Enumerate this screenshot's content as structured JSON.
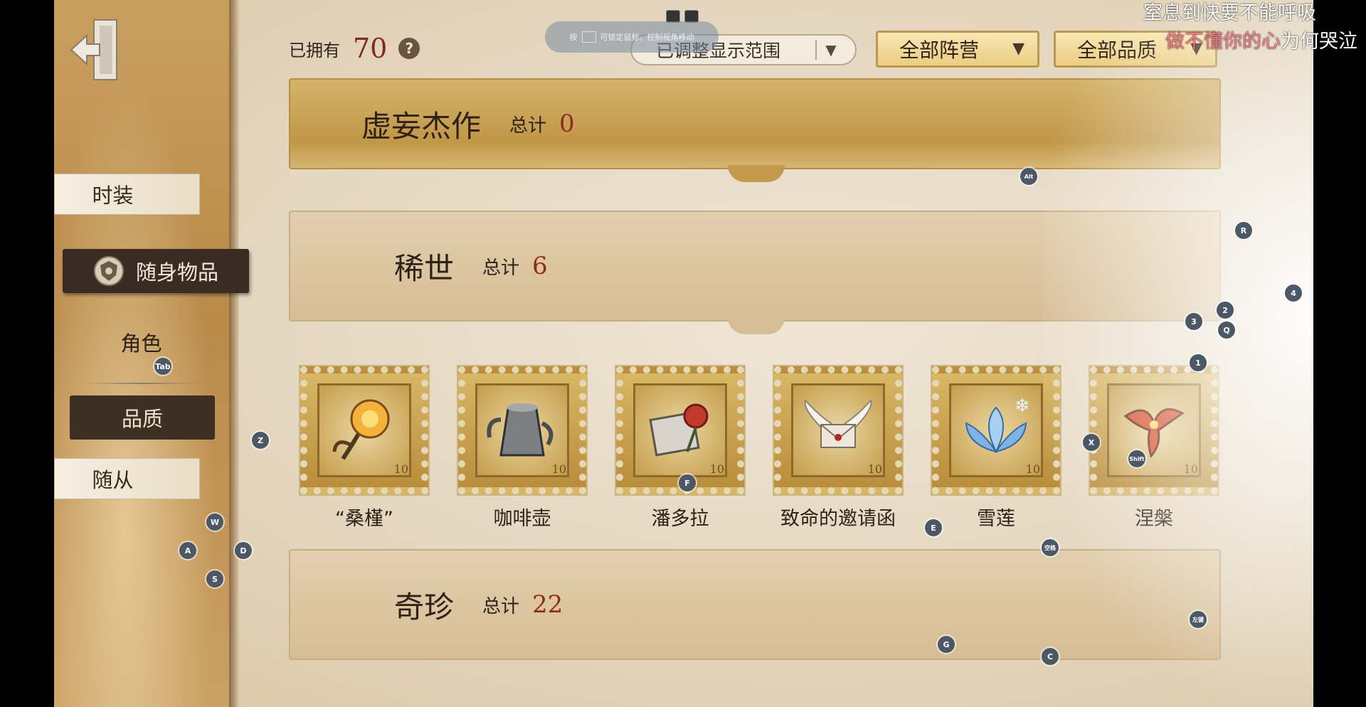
{
  "header": {
    "owned_label": "已拥有",
    "owned_count": "70",
    "help_glyph": "?",
    "range_dropdown": "已调整显示范围",
    "camp_dropdown": "全部阵营",
    "quality_dropdown": "全部品质"
  },
  "hud": {
    "hint_prefix": "按",
    "hint_text": "可锁定鼠标，控制视角移动"
  },
  "sidebar": {
    "items": [
      {
        "label": "时装"
      },
      {
        "label": "随身物品"
      },
      {
        "label": "角色"
      },
      {
        "label": "品质"
      },
      {
        "label": "随从"
      }
    ]
  },
  "sections": [
    {
      "title": "虚妄杰作",
      "total_label": "总计",
      "total": "0"
    },
    {
      "title": "稀世",
      "total_label": "总计",
      "total": "6"
    },
    {
      "title": "奇珍",
      "total_label": "总计",
      "total": "22"
    }
  ],
  "items": [
    {
      "name": "“桑槿”",
      "icon": "flower-branch-icon",
      "face": "10"
    },
    {
      "name": "咖啡壶",
      "icon": "coffee-pot-icon",
      "face": "10"
    },
    {
      "name": "潘多拉",
      "icon": "box-rose-icon",
      "face": "10"
    },
    {
      "name": "致命的邀请函",
      "icon": "winged-letter-icon",
      "face": "10"
    },
    {
      "name": "雪莲",
      "icon": "snow-lotus-icon",
      "face": "10"
    },
    {
      "name": "涅槃",
      "icon": "phoenix-icon",
      "face": "10"
    }
  ],
  "key_hints": {
    "tab": "Tab",
    "alt": "Alt",
    "r": "R",
    "num4": "4",
    "num2": "2",
    "num3": "3",
    "q": "Q",
    "num1": "1",
    "z": "Z",
    "x": "X",
    "shift": "Shift",
    "f": "F",
    "w": "W",
    "a": "A",
    "d": "D",
    "s": "S",
    "e": "E",
    "space": "空格",
    "leftclick": "左键",
    "g": "G",
    "c": "C"
  },
  "stream_overlay": {
    "line1": "窒息到快要不能呼吸",
    "line2_pink": "做不懂你的心",
    "line2_rest": "为何哭泣"
  },
  "colors": {
    "accent_red": "#8e2b20",
    "nav_active": "#3a2c22",
    "gold": "#c19748"
  }
}
